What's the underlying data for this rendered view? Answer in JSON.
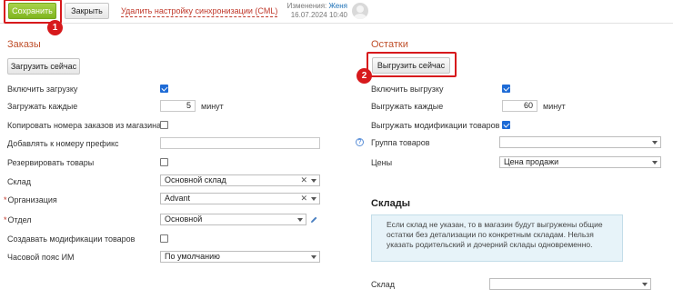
{
  "toolbar": {
    "save_label": "Сохранить",
    "close_label": "Закрыть",
    "delete_sync_label": "Удалить настройку синхронизации (CML)",
    "changes_prefix": "Изменения:",
    "changes_user": "Женя",
    "changes_date": "16.07.2024 10:40"
  },
  "markers": {
    "m1": "1",
    "m2": "2"
  },
  "orders": {
    "title": "Заказы",
    "load_now_label": "Загрузить сейчас",
    "enable_load_label": "Включить загрузку",
    "enable_load_checked": true,
    "load_every_label": "Загружать каждые",
    "load_every_value": "5",
    "load_every_unit": "минут",
    "copy_numbers_label": "Копировать номера заказов из магазина",
    "copy_numbers_checked": false,
    "prefix_label": "Добавлять к номеру префикс",
    "prefix_value": "",
    "reserve_label": "Резервировать товары",
    "reserve_checked": false,
    "warehouse_label": "Склад",
    "warehouse_value": "Основной склад",
    "org_label": "Организация",
    "org_value": "Advant",
    "dept_label": "Отдел",
    "dept_value": "Основной",
    "create_mods_label": "Создавать модификации товаров",
    "create_mods_checked": false,
    "timezone_label": "Часовой пояс ИМ",
    "timezone_value": "По умолчанию"
  },
  "stocks": {
    "title": "Остатки",
    "export_now_label": "Выгрузить сейчас",
    "enable_export_label": "Включить выгрузку",
    "enable_export_checked": true,
    "export_every_label": "Выгружать каждые",
    "export_every_value": "60",
    "export_every_unit": "минут",
    "export_mods_label": "Выгружать модификации товаров",
    "export_mods_checked": true,
    "group_label": "Группа товаров",
    "group_value": "",
    "prices_label": "Цены",
    "prices_value": "Цена продажи"
  },
  "warehouses": {
    "title": "Склады",
    "info_text": "Если склад не указан, то в магазин будут выгружены общие остатки без детализации по конкретным складам. Нельзя указать родительский и дочерний склады одновременно.",
    "warehouse_label": "Склад",
    "warehouse_value": ""
  },
  "colors": {
    "accent_red": "#d7191c",
    "save_green": "#8cc22a",
    "link_blue": "#1a6fb6",
    "checkbox_blue": "#1e6bd6"
  }
}
